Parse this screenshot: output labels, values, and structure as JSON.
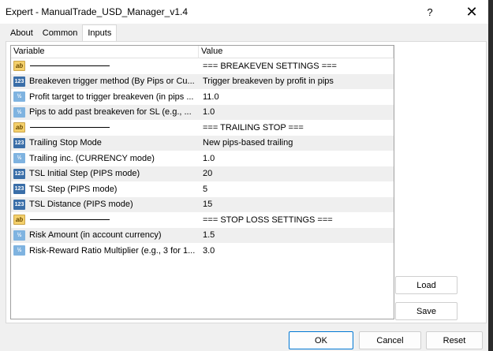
{
  "window": {
    "title": "Expert - ManualTrade_USD_Manager_v1.4",
    "help_label": "?",
    "close_label": "✕"
  },
  "tabs": [
    {
      "label": "About",
      "active": false
    },
    {
      "label": "Common",
      "active": false
    },
    {
      "label": "Inputs",
      "active": true
    }
  ],
  "grid": {
    "headers": {
      "variable": "Variable",
      "value": "Value"
    },
    "rows": [
      {
        "type": "string",
        "icon": "ab-icon",
        "variable": "",
        "separator": true,
        "value": "=== BREAKEVEN SETTINGS ==="
      },
      {
        "type": "int",
        "icon": "123-icon",
        "variable": "Breakeven trigger method (By Pips or Cu...",
        "value": "Trigger breakeven by profit in pips"
      },
      {
        "type": "double",
        "icon": "v2-icon",
        "variable": "Profit target to trigger breakeven (in pips ...",
        "value": "11.0"
      },
      {
        "type": "double",
        "icon": "v2-icon",
        "variable": "Pips to add past breakeven for SL (e.g., ...",
        "value": "1.0"
      },
      {
        "type": "string",
        "icon": "ab-icon",
        "variable": "",
        "separator": true,
        "value": "=== TRAILING STOP ==="
      },
      {
        "type": "int",
        "icon": "123-icon",
        "variable": "Trailing Stop Mode",
        "value": "New pips-based trailing"
      },
      {
        "type": "double",
        "icon": "v2-icon",
        "variable": "Trailing inc. (CURRENCY mode)",
        "value": "1.0"
      },
      {
        "type": "int",
        "icon": "123-icon",
        "variable": "TSL Initial Step (PIPS mode)",
        "value": "20"
      },
      {
        "type": "int",
        "icon": "123-icon",
        "variable": "TSL Step (PIPS mode)",
        "value": "5"
      },
      {
        "type": "int",
        "icon": "123-icon",
        "variable": "TSL Distance (PIPS mode)",
        "value": "15"
      },
      {
        "type": "string",
        "icon": "ab-icon",
        "variable": "",
        "separator": true,
        "value": "=== STOP LOSS SETTINGS ==="
      },
      {
        "type": "double",
        "icon": "v2-icon",
        "variable": "Risk Amount (in account currency)",
        "value": "1.5"
      },
      {
        "type": "double",
        "icon": "v2-icon",
        "variable": "Risk-Reward Ratio Multiplier (e.g., 3 for 1...",
        "value": "3.0"
      }
    ]
  },
  "side_buttons": {
    "load": "Load",
    "save": "Save"
  },
  "footer": {
    "ok": "OK",
    "cancel": "Cancel",
    "reset": "Reset"
  },
  "colors": {
    "accent": "#0078d4",
    "alt_row": "#efefef",
    "int_icon": "#3a6ea8",
    "double_icon": "#7fb3e0",
    "string_icon": "#f4d06b"
  }
}
